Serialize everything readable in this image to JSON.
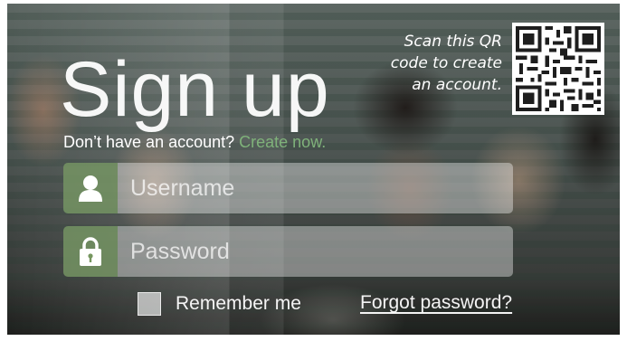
{
  "title": "Sign up",
  "account_prompt": {
    "text": "Don’t have an account? ",
    "link": "Create now."
  },
  "qr": {
    "line1": "Scan this QR",
    "line2": "code to create",
    "line3": "an account.",
    "icon": "qr-code"
  },
  "username": {
    "placeholder": "Username",
    "value": "",
    "icon": "user-icon"
  },
  "password": {
    "placeholder": "Password",
    "value": "",
    "icon": "lock-icon"
  },
  "remember": {
    "label": "Remember me",
    "checked": false
  },
  "forgot": {
    "label": "Forgot password?"
  },
  "colors": {
    "accent_green": "#7fb27a",
    "icon_box": "#76965f"
  }
}
